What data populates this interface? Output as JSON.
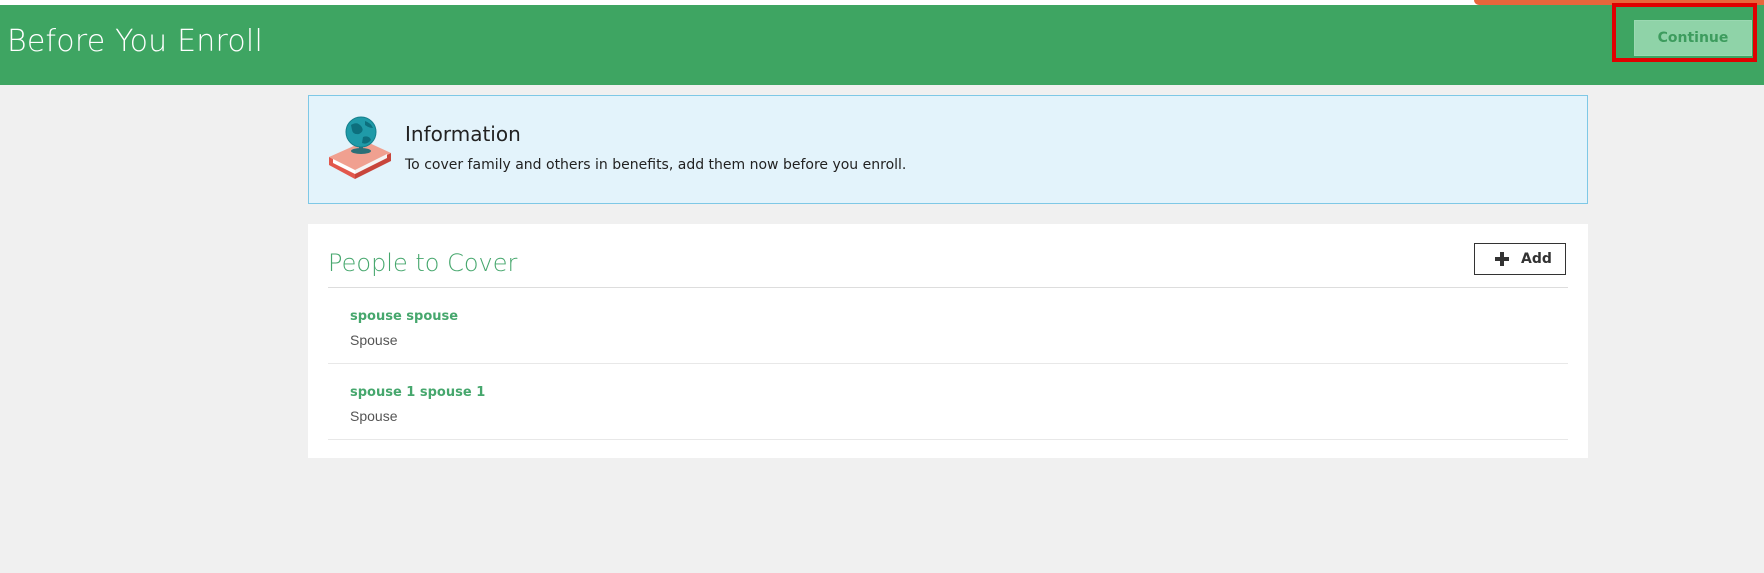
{
  "header": {
    "title": "Before You Enroll",
    "continue_label": "Continue"
  },
  "info": {
    "heading": "Information",
    "text": "To cover family and others in benefits, add them now before you enroll.",
    "icon": "book-globe-icon"
  },
  "people": {
    "title": "People to Cover",
    "add_label": "Add",
    "items": [
      {
        "name": "spouse spouse",
        "relation": "Spouse"
      },
      {
        "name": "spouse 1 spouse 1",
        "relation": "Spouse"
      }
    ]
  },
  "colors": {
    "header_green": "#3ea562",
    "accent_green": "#46a76d",
    "highlight_red": "#e00000",
    "info_background": "#e3f3fb"
  }
}
